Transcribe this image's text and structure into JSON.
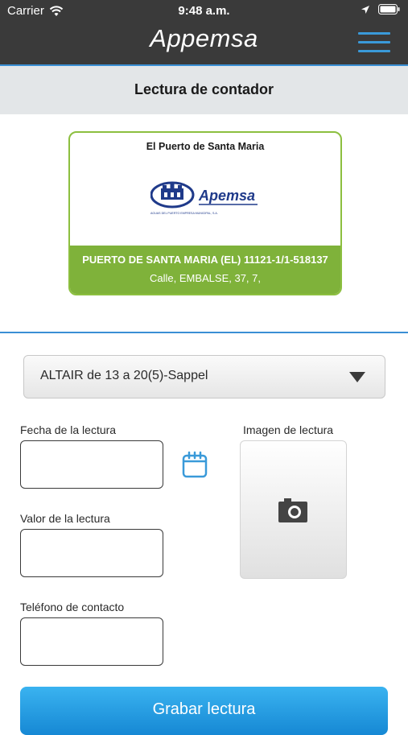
{
  "status_bar": {
    "carrier": "Carrier",
    "time": "9:48 a.m."
  },
  "nav": {
    "app_title": "Appemsa"
  },
  "header": {
    "title": "Lectura de contador"
  },
  "meter_card": {
    "city": "El Puerto de Santa Maria",
    "logo_text": "Apemsa",
    "logo_subtitle": "AGUAS DEL PUERTO EMPRESA MUNICIPAL, S.A.",
    "account": "PUERTO DE SANTA MARIA (EL) 11121-1/1-518137",
    "address": "Calle, EMBALSE, 37, 7,"
  },
  "meter_select": {
    "selected": "ALTAIR de 13 a 20(5)-Sappel"
  },
  "form": {
    "reading_date_label": "Fecha de la lectura",
    "reading_value_label": "Valor de la lectura",
    "contact_phone_label": "Teléfono de contacto",
    "reading_image_label": "Imagen de lectura",
    "reading_date_value": "",
    "reading_value_value": "",
    "contact_phone_value": ""
  },
  "actions": {
    "save_label": "Grabar lectura"
  },
  "colors": {
    "nav_bg": "#3a3a3a",
    "accent_blue": "#3a8fd4",
    "card_green": "#7fb23a",
    "button_blue": "#1e96e0"
  },
  "icons": [
    "wifi-icon",
    "location-arrow-icon",
    "battery-icon",
    "hamburger-menu-icon",
    "calendar-icon",
    "camera-icon",
    "dropdown-arrow-icon"
  ]
}
